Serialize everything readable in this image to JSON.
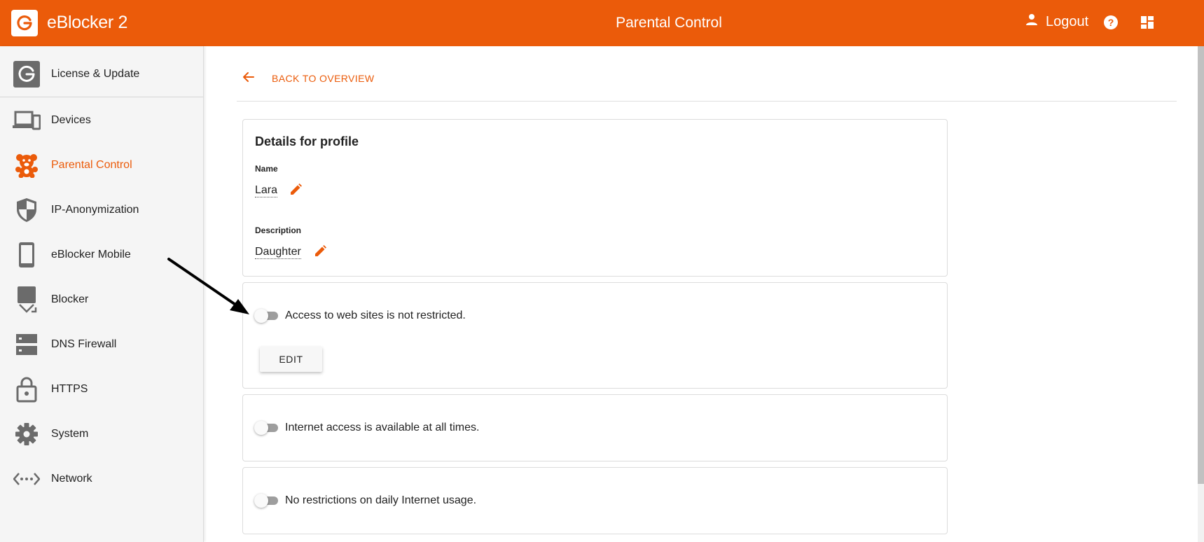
{
  "header": {
    "brand": "eBlocker 2",
    "title": "Parental Control",
    "logout_label": "Logout"
  },
  "colors": {
    "accent": "#eb5b0a",
    "sidebar_bg": "#f5f5f5",
    "icon_gray": "#6b6b6b"
  },
  "sidebar": {
    "items": [
      {
        "label": "License & Update",
        "icon": "refresh-logo-icon",
        "active": false
      },
      {
        "label": "Devices",
        "icon": "devices-icon",
        "active": false
      },
      {
        "label": "Parental Control",
        "icon": "teddy-bear-icon",
        "active": true
      },
      {
        "label": "IP-Anonymization",
        "icon": "shield-icon",
        "active": false
      },
      {
        "label": "eBlocker Mobile",
        "icon": "smartphone-icon",
        "active": false
      },
      {
        "label": "Blocker",
        "icon": "blocker-icon",
        "active": false
      },
      {
        "label": "DNS Firewall",
        "icon": "dns-icon",
        "active": false
      },
      {
        "label": "HTTPS",
        "icon": "lock-icon",
        "active": false
      },
      {
        "label": "System",
        "icon": "gear-icon",
        "active": false
      },
      {
        "label": "Network",
        "icon": "network-icon",
        "active": false
      }
    ]
  },
  "main": {
    "back_label": "BACK TO OVERVIEW",
    "profile": {
      "title": "Details for profile",
      "name_label": "Name",
      "name_value": "Lara",
      "description_label": "Description",
      "description_value": "Daughter"
    },
    "restrictions": [
      {
        "text": "Access to web sites is not restricted.",
        "enabled": false,
        "button": "EDIT"
      },
      {
        "text": "Internet access is available at all times.",
        "enabled": false
      },
      {
        "text": "No restrictions on daily Internet usage.",
        "enabled": false
      }
    ]
  }
}
